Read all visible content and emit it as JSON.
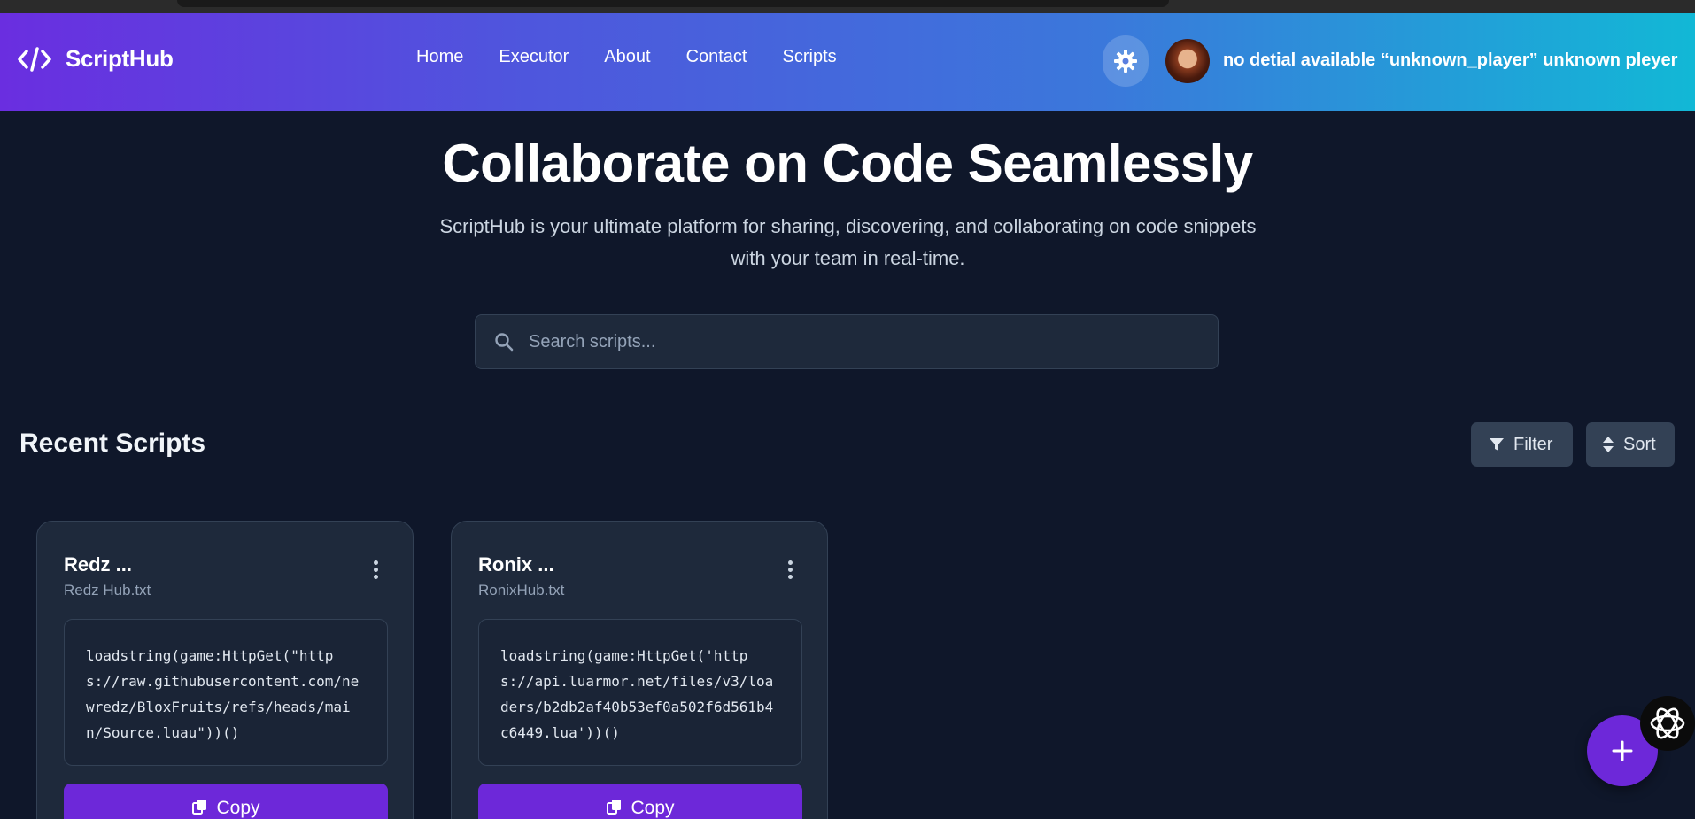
{
  "header": {
    "logo_text": "ScriptHub",
    "nav": [
      "Home",
      "Executor",
      "About",
      "Contact",
      "Scripts"
    ],
    "user_name": "no detial available “unknown_player” unknown pleyer"
  },
  "hero": {
    "title": "Collaborate on Code Seamlessly",
    "subtitle": "ScriptHub is your ultimate platform for sharing, discovering, and collaborating on code snippets with your team in real-time."
  },
  "search": {
    "placeholder": "Search scripts..."
  },
  "section": {
    "title": "Recent Scripts",
    "filter_label": "Filter",
    "sort_label": "Sort"
  },
  "cards": [
    {
      "title": "Redz ...",
      "file": "Redz Hub.txt",
      "code": "loadstring(game:HttpGet(\"https://raw.githubusercontent.com/newredz/BloxFruits/refs/heads/main/Source.luau\"))()",
      "copy_label": "Copy"
    },
    {
      "title": "Ronix ...",
      "file": "RonixHub.txt",
      "code": "loadstring(game:HttpGet('https://api.luarmor.net/files/v3/loaders/b2db2af40b53ef0a502f6d561b4c6449.lua'))()",
      "copy_label": "Copy"
    }
  ],
  "colors": {
    "background": "#0f172a",
    "accent": "#6d28d9",
    "card": "#1e293b",
    "header_gradient_start": "#6a2ee0",
    "header_gradient_end": "#12b8d6"
  },
  "icons": {
    "logo": "code-icon",
    "theme": "gear-icon",
    "search": "search-icon",
    "filter": "funnel-icon",
    "sort": "sort-icon",
    "card_menu": "kebab-menu-icon",
    "copy": "copy-icon",
    "fab": "plus-icon",
    "extension": "openai-logo-icon"
  }
}
